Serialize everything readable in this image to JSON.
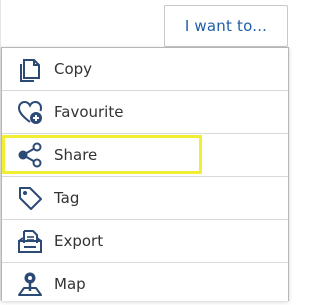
{
  "header": {
    "want_button_label": "I want to..."
  },
  "menu": {
    "items": [
      {
        "label": "Copy",
        "icon": "copy-icon"
      },
      {
        "label": "Favourite",
        "icon": "favourite-add-icon"
      },
      {
        "label": "Share",
        "icon": "share-icon",
        "highlighted": true
      },
      {
        "label": "Tag",
        "icon": "tag-icon"
      },
      {
        "label": "Export",
        "icon": "export-icon"
      },
      {
        "label": "Map",
        "icon": "map-pin-icon"
      }
    ]
  },
  "colors": {
    "icon": "#2b4a75",
    "accent": "#1f5ea8",
    "highlight": "#f2ee33",
    "text": "#333333",
    "border": "#b7b7b7"
  }
}
